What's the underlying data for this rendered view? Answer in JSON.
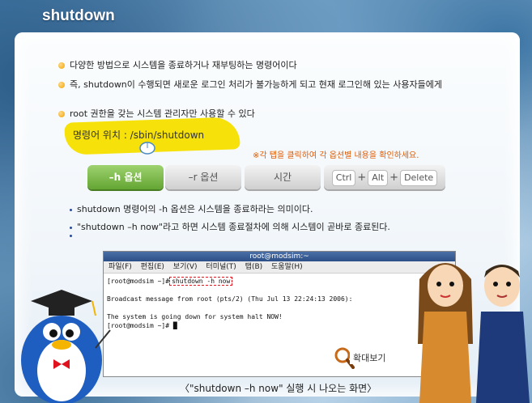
{
  "header": {
    "title": "shutdown"
  },
  "bullets": [
    "다양한 방법으로 시스템을 종료하거나 재부팅하는 명령어이다",
    "즉, shutdown이 수행되면 새로운 로그인 처리가 불가능하게 되고 현재 로그인해 있는 사용자들에게",
    "root 권한을 갖는 시스템 관리자만 사용할 수 있다"
  ],
  "command_location": "명령어 위치 : /sbin/shutdown",
  "hint": "※각 탭을 클릭하여 각 옵션별 내용을 확인하세요.",
  "tabs": {
    "h": "–h 옵션",
    "r": "–r 옵션",
    "time": "시간",
    "ctrl": "Ctrl",
    "alt": "Alt",
    "delete": "Delete",
    "plus": "+"
  },
  "sub_bullets": [
    "shutdown 명령어의 -h 옵션은 시스템을 종료하라는 의미이다.",
    "\"shutdown –h now\"라고 하면 시스템 종료절차에 의해 시스템이 곧바로 종료된다.",
    ""
  ],
  "terminal": {
    "title": "root@modsim:~",
    "menu": [
      "파일(F)",
      "편집(E)",
      "보기(V)",
      "터미널(T)",
      "탭(B)",
      "도움말(H)"
    ],
    "prompt": "[root@modsim ~]#",
    "command": "shutdown -h now",
    "line2": "Broadcast message from root (pts/2) (Thu Jul 13 22:24:13 2006):",
    "line3": "The system is going down for system halt NOW!",
    "line4": "[root@modsim ~]# █"
  },
  "zoom_label": "확대보기",
  "caption": "〈\"shutdown –h now\" 실행 시 나오는 화면〉"
}
